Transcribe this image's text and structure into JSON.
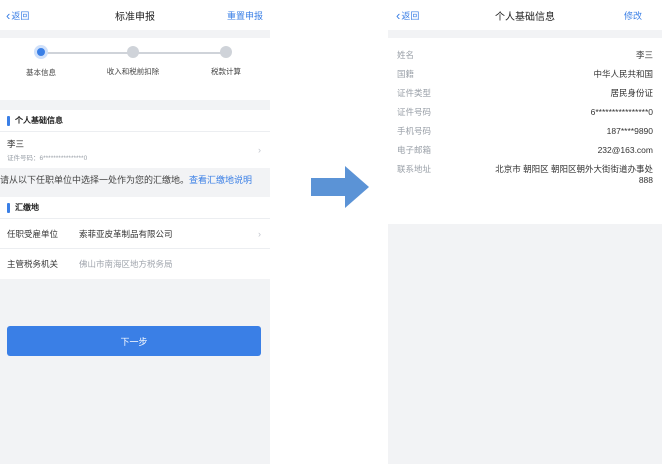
{
  "left": {
    "nav": {
      "back": "返回",
      "title": "标准申报",
      "action": "重置申报"
    },
    "steps": [
      "基本信息",
      "收入和税前扣除",
      "税款计算"
    ],
    "personal_section_title": "个人基础信息",
    "person": {
      "name": "李三",
      "id_line": "证件号码：6****************0"
    },
    "hint": {
      "text": "请从以下任职单位中选择一处作为您的汇缴地。",
      "link": "查看汇缴地说明"
    },
    "remit_section_title": "汇缴地",
    "form": {
      "employer_label": "任职受雇单位",
      "employer_value": "索菲亚皮革制品有限公司",
      "tax_office_label": "主管税务机关",
      "tax_office_value": "佛山市南海区地方税务局"
    },
    "next_button": "下一步"
  },
  "right": {
    "nav": {
      "back": "返回",
      "title": "个人基础信息",
      "action": "修改"
    },
    "rows": [
      {
        "label": "姓名",
        "value": "李三"
      },
      {
        "label": "国籍",
        "value": "中华人民共和国"
      },
      {
        "label": "证件类型",
        "value": "居民身份证"
      },
      {
        "label": "证件号码",
        "value": "6****************0"
      },
      {
        "label": "手机号码",
        "value": "187****9890"
      },
      {
        "label": "电子邮箱",
        "value": "232@163.com"
      },
      {
        "label": "联系地址",
        "value": "北京市 朝阳区 朝阳区朝外大街街道办事处 888"
      }
    ]
  },
  "colors": {
    "accent": "#3a7fe6",
    "arrow": "#5b93d6"
  },
  "icons": {
    "back": "chevron-left-icon",
    "row": "chevron-right-icon",
    "flow": "arrow-right-icon"
  }
}
